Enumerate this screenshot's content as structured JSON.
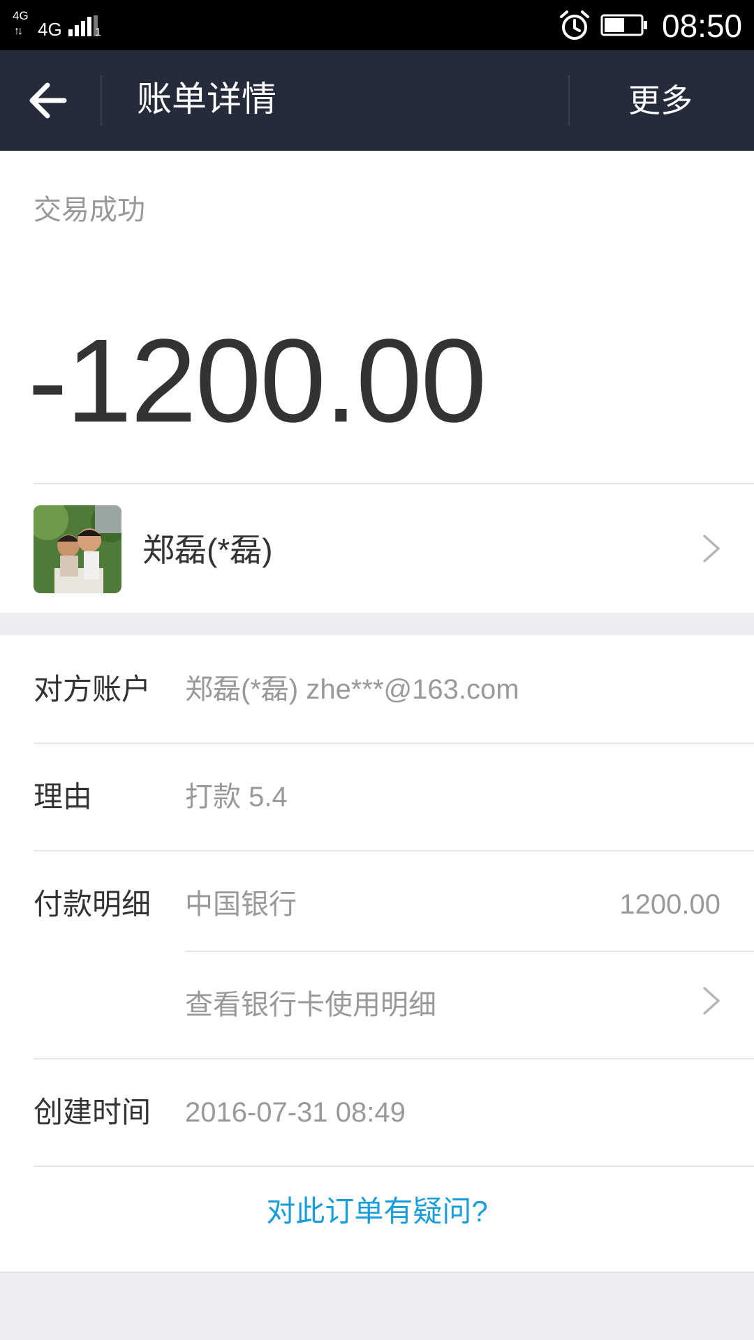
{
  "status_bar": {
    "network_top": "4G",
    "network_main": "4G",
    "sim_slot": "1",
    "time": "08:50",
    "icons": [
      "signal-icon",
      "alarm-icon",
      "battery-icon"
    ]
  },
  "header": {
    "back_icon": "back-arrow-icon",
    "title": "账单详情",
    "more_label": "更多"
  },
  "summary": {
    "status": "交易成功",
    "amount": "-1200.00",
    "payee_name": "郑磊(*磊)",
    "chevron_icon": "chevron-right-icon"
  },
  "details": {
    "account_label": "对方账户",
    "account_value": "郑磊(*磊) zhe***@163.com",
    "reason_label": "理由",
    "reason_value": "打款  5.4",
    "payment_label": "付款明细",
    "payment_bank": "中国银行",
    "payment_amount": "1200.00",
    "bank_card_link": "查看银行卡使用明细",
    "created_label": "创建时间",
    "created_value": "2016-07-31 08:49",
    "question_link": "对此订单有疑问?"
  },
  "colors": {
    "header_bg": "#252b3a",
    "link": "#1a9ddb",
    "page_bg": "#ebedf0"
  }
}
